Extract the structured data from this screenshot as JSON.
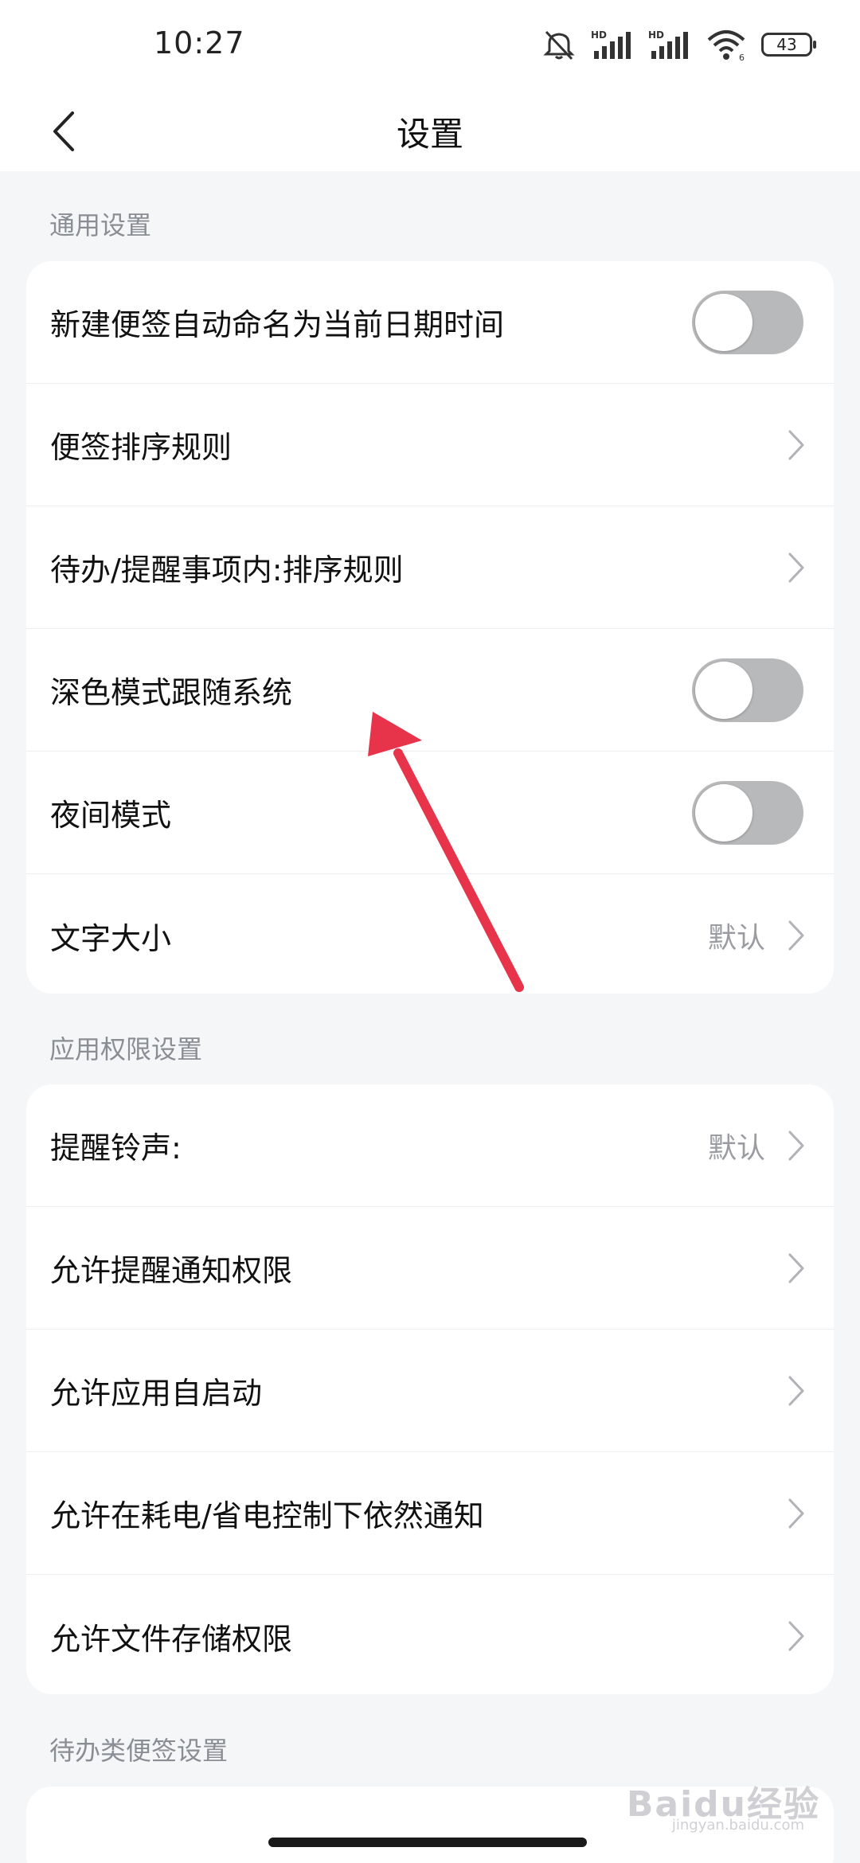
{
  "status_bar": {
    "time": "10:27",
    "battery_level": "43",
    "icons": [
      "mute-icon",
      "signal-hd-icon",
      "signal-hd-icon",
      "wifi-icon",
      "battery-icon"
    ]
  },
  "header": {
    "title": "设置",
    "back_icon": "chevron-left-icon"
  },
  "sections": [
    {
      "label": "通用设置",
      "items": [
        {
          "label": "新建便签自动命名为当前日期时间",
          "control": "toggle",
          "on": false
        },
        {
          "label": "便签排序规则",
          "control": "chevron"
        },
        {
          "label": "待办/提醒事项内:排序规则",
          "control": "chevron"
        },
        {
          "label": "深色模式跟随系统",
          "control": "toggle",
          "on": false
        },
        {
          "label": "夜间模式",
          "control": "toggle",
          "on": false
        },
        {
          "label": "文字大小",
          "control": "chevron",
          "value": "默认"
        }
      ]
    },
    {
      "label": "应用权限设置",
      "items": [
        {
          "label": "提醒铃声:",
          "control": "chevron",
          "value": "默认"
        },
        {
          "label": "允许提醒通知权限",
          "control": "chevron"
        },
        {
          "label": "允许应用自启动",
          "control": "chevron"
        },
        {
          "label": "允许在耗电/省电控制下依然通知",
          "control": "chevron"
        },
        {
          "label": "允许文件存储权限",
          "control": "chevron"
        }
      ]
    },
    {
      "label": "待办类便签设置",
      "items": []
    }
  ],
  "watermark": {
    "text": "Baidu经验",
    "sub": "jingyan.baidu.com"
  },
  "colors": {
    "background": "#f5f6f8",
    "card": "#ffffff",
    "toggle_off": "#b8b9bb",
    "secondary_text": "#8a8d93",
    "annotation_arrow": "#e8344a"
  }
}
